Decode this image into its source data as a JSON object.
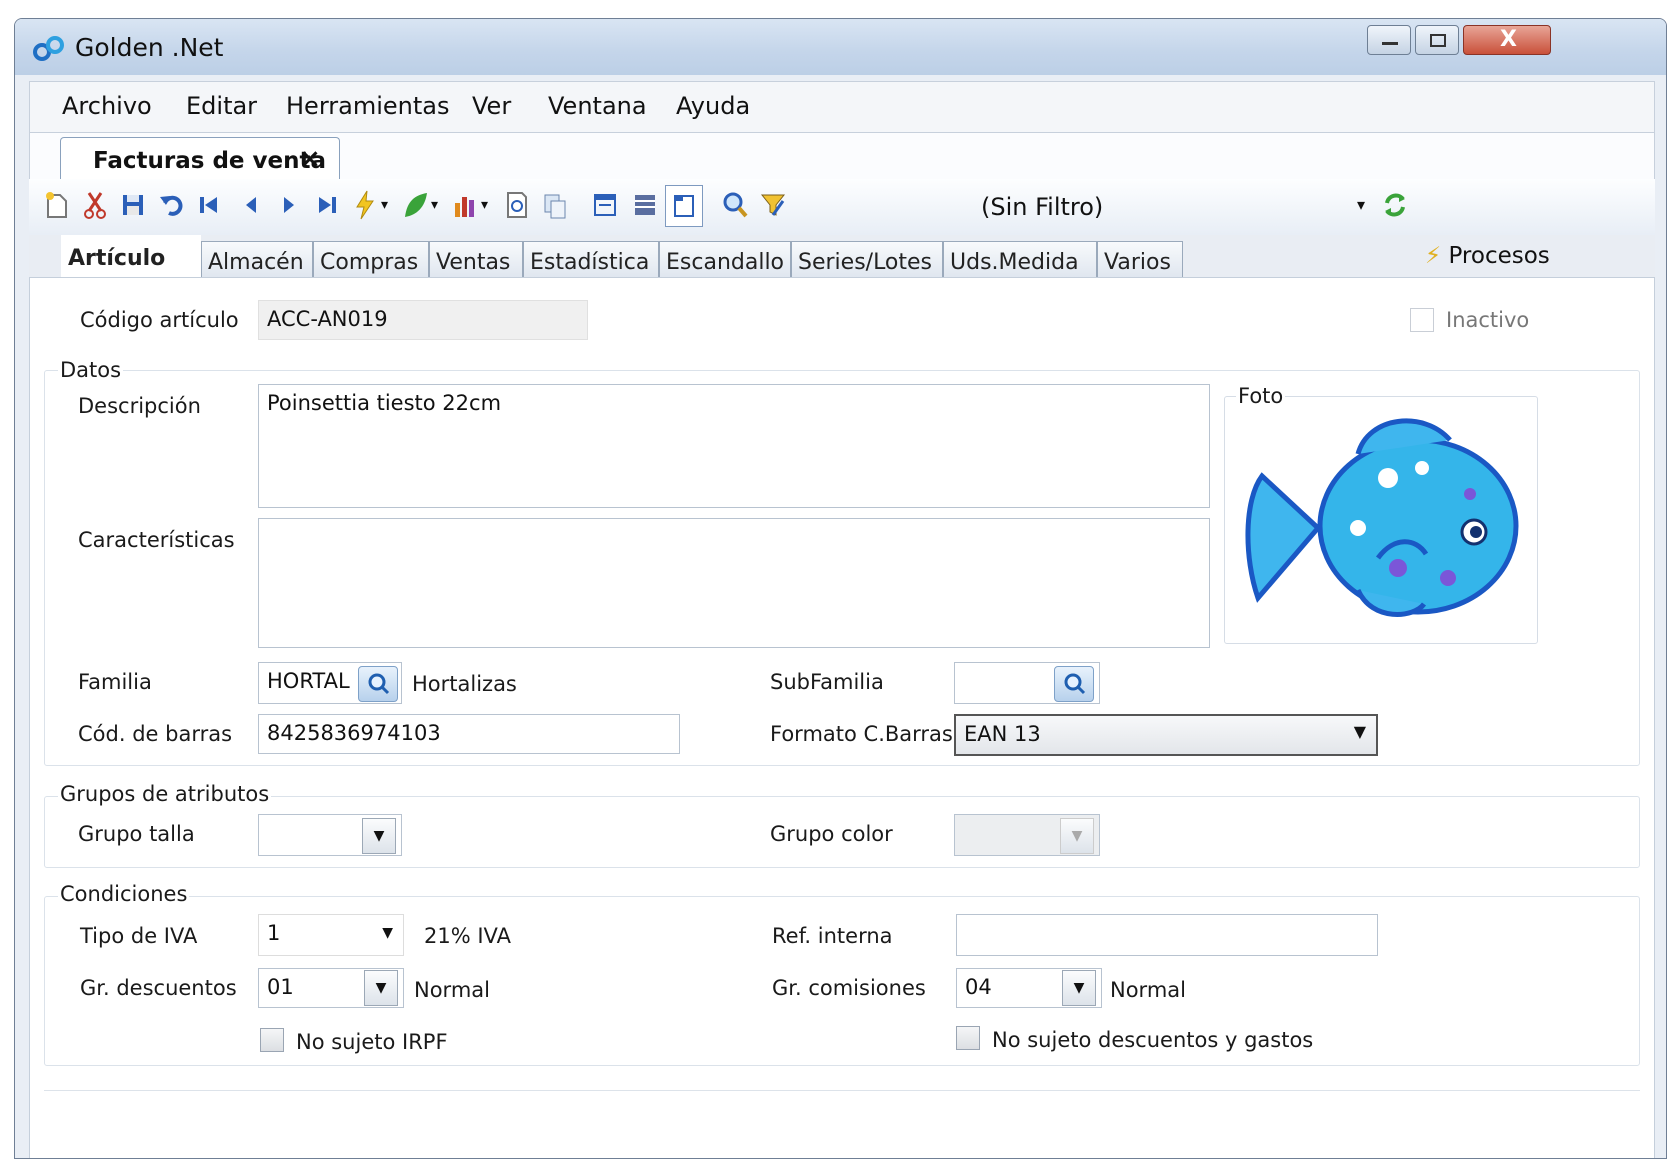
{
  "window": {
    "title": "Golden .Net",
    "min_label": "—",
    "max_label": "▫",
    "close_label": "X"
  },
  "menu": [
    "Archivo",
    "Editar",
    "Herramientas",
    "Ver",
    "Ventana",
    "Ayuda"
  ],
  "doc_tab": {
    "label": "Facturas de venta",
    "close": "×"
  },
  "toolbar": {
    "filter_label": "(Sin Filtro)",
    "icons": [
      "new-icon",
      "cut-icon",
      "save-icon",
      "undo-icon",
      "first-record-icon",
      "prev-record-icon",
      "next-record-icon",
      "last-record-icon",
      "lightning-icon",
      "leaf-icon",
      "chart-icon",
      "print-preview-icon",
      "copy-icon",
      "form-icon",
      "grid-icon",
      "page-icon",
      "search-icon",
      "filter-icon",
      "refresh-icon"
    ]
  },
  "tabs": [
    "Artículo",
    "Almacén",
    "Compras",
    "Ventas",
    "Estadística",
    "Escandallo",
    "Series/Lotes",
    "Uds.Medida",
    "Varios"
  ],
  "procesos_label": "Procesos",
  "form": {
    "codigo_label": "Código artículo",
    "codigo_value": "ACC-AN019",
    "inactivo_label": "Inactivo",
    "datos_title": "Datos",
    "descripcion_label": "Descripción",
    "descripcion_value": "Poinsettia tiesto 22cm",
    "caracteristicas_label": "Características",
    "caracteristicas_value": "",
    "foto_title": "Foto",
    "familia_label": "Familia",
    "familia_code": "HORTAL",
    "familia_name": "Hortalizas",
    "subfamilia_label": "SubFamilia",
    "subfamilia_value": "",
    "barras_label": "Cód. de barras",
    "barras_value": "8425836974103",
    "formato_label": "Formato C.Barras",
    "formato_value": "EAN 13",
    "atributos_title": "Grupos de atributos",
    "talla_label": "Grupo talla",
    "talla_value": "",
    "color_label": "Grupo color",
    "color_value": "",
    "condiciones_title": "Condiciones",
    "iva_label": "Tipo de IVA",
    "iva_value": "1",
    "iva_desc": "21% IVA",
    "ref_label": "Ref. interna",
    "ref_value": "",
    "desc_label": "Gr. descuentos",
    "desc_value": "01",
    "desc_desc": "Normal",
    "com_label": "Gr. comisiones",
    "com_value": "04",
    "com_desc": "Normal",
    "irpf_label": "No sujeto IRPF",
    "gastos_label": "No sujeto descuentos y gastos"
  },
  "colors": {
    "accent": "#2f7bd0",
    "fish": "#33b3ea",
    "title_bar": "#c4d5ea"
  }
}
